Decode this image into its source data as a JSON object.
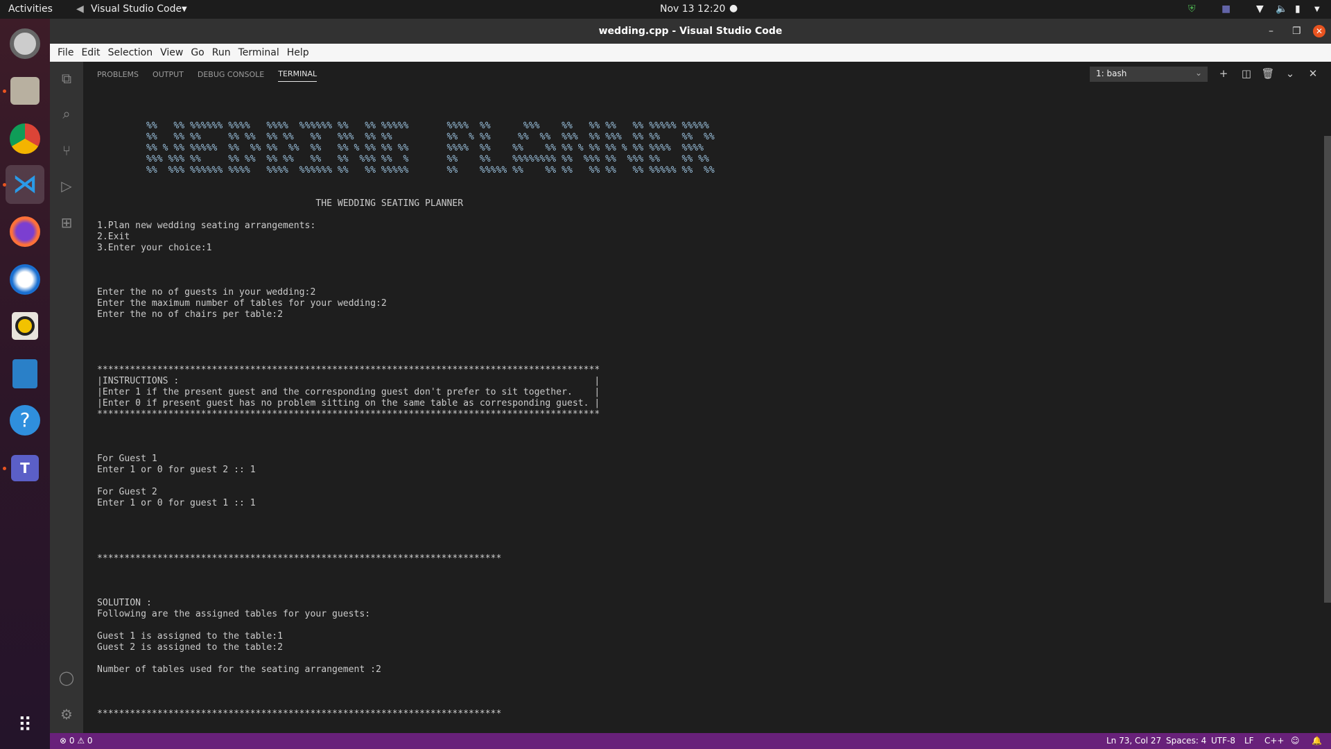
{
  "topbar": {
    "activities": "Activities",
    "app_name": "Visual Studio Code",
    "clock": "Nov 13  12:20"
  },
  "window": {
    "title": "wedding.cpp - Visual Studio Code"
  },
  "menu": [
    "File",
    "Edit",
    "Selection",
    "View",
    "Go",
    "Run",
    "Terminal",
    "Help"
  ],
  "panel": {
    "tabs": [
      "PROBLEMS",
      "OUTPUT",
      "DEBUG CONSOLE",
      "TERMINAL"
    ],
    "active_tab": "TERMINAL",
    "terminal_select": "1: bash"
  },
  "terminal": {
    "art": [
      "%%   %% %%%%%% %%%%   %%%%  %%%%%% %%   %% %%%%%       %%%%  %%      %%%    %%   %% %%   %% %%%%% %%%%%",
      "%%   %% %%     %% %%  %% %%   %%   %%%  %% %%          %%  % %%     %%  %%  %%%  %% %%%  %% %%    %%  %%",
      "%% % %% %%%%%  %%  %% %%  %%  %%   %% % %% %% %%       %%%%  %%    %%    %% %% % %% %% % %% %%%%  %%%%",
      "%%% %%% %%     %% %%  %% %%   %%   %%  %%% %%  %       %%    %%    %%%%%%%% %%  %%% %%  %%% %%    %% %%",
      "%%  %%% %%%%%% %%%%   %%%%  %%%%%% %%   %% %%%%%       %%    %%%%% %%    %% %%   %% %%   %% %%%%% %%  %%"
    ],
    "heading": "THE WEDDING SEATING PLANNER",
    "menu_lines": [
      "1.Plan new wedding seating arrangements:",
      "2.Exit",
      "3.Enter your choice:1"
    ],
    "input_lines": [
      "Enter the no of guests in your wedding:2",
      "Enter the maximum number of tables for your wedding:2",
      "Enter the no of chairs per table:2"
    ],
    "stars_long": "********************************************************************************************",
    "instructions": [
      "|INSTRUCTIONS :                                                                            |",
      "|Enter 1 if the present guest and the corresponding guest don't prefer to sit together.    |",
      "|Enter 0 if present guest has no problem sitting on the same table as corresponding guest. |"
    ],
    "guest_blocks": [
      [
        "For Guest 1",
        "Enter 1 or 0 for guest 2 :: 1"
      ],
      [
        "For Guest 2",
        "Enter 1 or 0 for guest 1 :: 1"
      ]
    ],
    "stars_short": "**************************************************************************",
    "solution": [
      "SOLUTION :",
      "Following are the assigned tables for your guests:"
    ],
    "assignments": [
      "Guest 1 is assigned to the table:1",
      "Guest 2 is assigned to the table:2"
    ],
    "tables_used": "Number of tables used for the seating arrangement :2"
  },
  "status": {
    "errors": "0",
    "warnings": "0",
    "position": "Ln 73, Col 27",
    "spaces": "Spaces: 4",
    "encoding": "UTF-8",
    "eol": "LF",
    "language": "C++"
  },
  "colors": {
    "status_bar": "#68217a",
    "terminal_bg": "#1e1e1e",
    "close_button": "#e95420"
  }
}
